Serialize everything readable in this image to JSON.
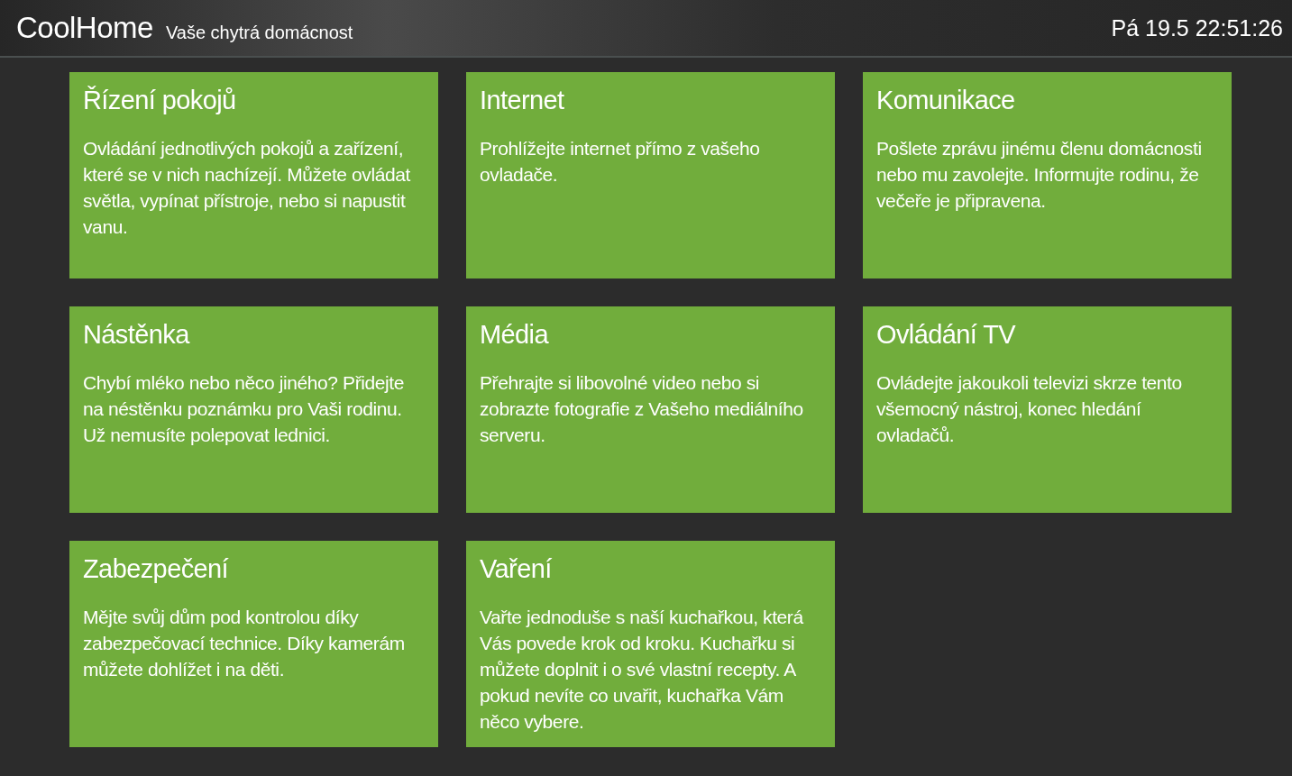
{
  "header": {
    "app_name": "CoolHome",
    "tagline": "Vaše chytrá domácnost",
    "datetime": "Pá 19.5 22:51:26"
  },
  "tiles": [
    {
      "title": "Řízení pokojů",
      "description": "Ovládání jednotlivých pokojů a zařízení, které se v nich nachízejí. Můžete ovládat světla, vypínat přístroje, nebo si napustit vanu."
    },
    {
      "title": "Internet",
      "description": "Prohlížejte internet přímo z vašeho ovladače."
    },
    {
      "title": "Komunikace",
      "description": "Pošlete zprávu jinému členu domácnosti nebo mu zavolejte. Informujte rodinu, že večeře je připravena."
    },
    {
      "title": "Nástěnka",
      "description": "Chybí mléko nebo něco jiného? Přidejte na néstěnku poznámku pro Vaši rodinu. Už nemusíte polepovat lednici."
    },
    {
      "title": "Média",
      "description": "Přehrajte si libovolné video nebo si zobrazte fotografie z Vašeho mediálního serveru."
    },
    {
      "title": "Ovládání TV",
      "description": "Ovládejte jakoukoli televizi skrze tento všemocný nástroj, konec hledání ovladačů."
    },
    {
      "title": "Zabezpečení",
      "description": "Mějte svůj dům pod kontrolou díky zabezpečovací technice. Díky kamerám můžete dohlížet i na děti."
    },
    {
      "title": "Vaření",
      "description": "Vařte jednoduše s naší kuchařkou, která Vás povede krok od kroku. Kuchařku si můžete doplnit i o své vlastní recepty. A pokud nevíte co uvařit, kuchařka Vám něco vybere."
    }
  ]
}
